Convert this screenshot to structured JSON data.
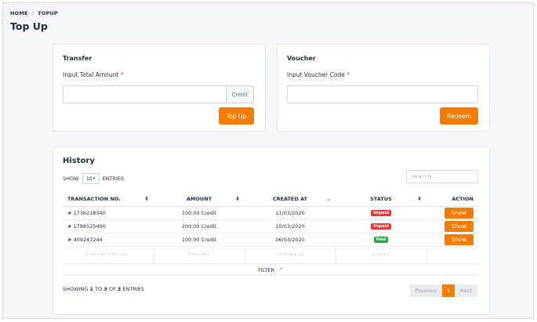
{
  "breadcrumb": {
    "home": "HOME",
    "separator": "/",
    "current": "TOPUP"
  },
  "page_title": "Top Up",
  "transfer": {
    "title": "Transfer",
    "label": "Input Total Amount",
    "required_mark": "*",
    "input_value": "",
    "addon": "Credit",
    "button": "Top Up"
  },
  "voucher": {
    "title": "Voucher",
    "label": "Input Voucher Code",
    "required_mark": "*",
    "input_value": "",
    "button": "Redeem"
  },
  "history": {
    "title": "History",
    "show_label": "SHOW",
    "entries_value": "10",
    "entries_label": "ENTRIES",
    "search_placeholder": "search...",
    "columns": [
      "TRANSACTION NO.",
      "AMOUNT",
      "CREATED AT",
      "STATUS",
      "ACTION"
    ],
    "rows": [
      {
        "tx": "# 1736218340",
        "amount": "100.00 Credit",
        "created": "11/03/2020",
        "status": "Unpaid",
        "action": "Show"
      },
      {
        "tx": "# 1788525490",
        "amount": "200.00 Credit",
        "created": "10/03/2020",
        "status": "Unpaid",
        "action": "Show"
      },
      {
        "tx": "# 409247244",
        "amount": "100.00 Credit",
        "created": "06/03/2020",
        "status": "Paid",
        "action": "Show"
      }
    ],
    "filters": [
      "transaction no.",
      "amount",
      "created at",
      "status",
      ""
    ],
    "filter_label": "FILTER",
    "showing": {
      "prefix": "SHOWING",
      "from": "1",
      "to_word": "TO",
      "to": "3",
      "of_word": "OF",
      "total": "3",
      "suffix": "ENTRIES"
    },
    "pagination": {
      "previous": "Previous",
      "current": "1",
      "next": "Next"
    }
  },
  "colors": {
    "accent": "#f57c00",
    "unpaid": "#e53935",
    "paid": "#28a745"
  },
  "icons": {
    "sort": "sort-icon",
    "sort_desc": "chevron-down-icon",
    "filter_toggle": "chevron-up-icon",
    "select_caret": "caret-down-icon"
  }
}
